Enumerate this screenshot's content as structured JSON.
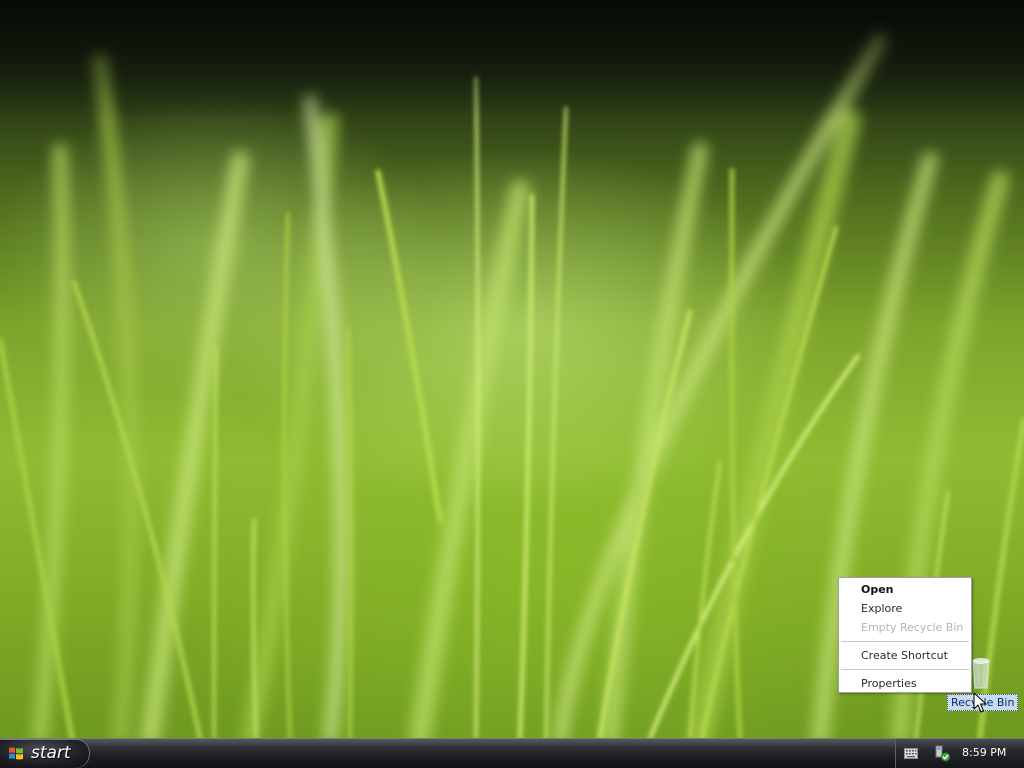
{
  "desktop": {
    "icons": [
      {
        "label": "Recycle Bin",
        "icon": "recycle-bin-icon"
      }
    ]
  },
  "context_menu": {
    "items": [
      {
        "label": "Open",
        "style": "default"
      },
      {
        "label": "Explore",
        "style": "normal"
      },
      {
        "label": "Empty Recycle Bin",
        "style": "disabled"
      },
      {
        "label": "Create Shortcut",
        "style": "normal"
      },
      {
        "label": "Properties",
        "style": "normal"
      }
    ]
  },
  "taskbar": {
    "start_label": "start",
    "tray": {
      "icons": [
        "keyboard-icon",
        "network-icon"
      ],
      "clock": "8:59 PM"
    }
  },
  "colors": {
    "wallpaper_green": "#8fbb33",
    "taskbar_dark": "#1d1f23",
    "selection_blue": "#c7dcf2"
  }
}
